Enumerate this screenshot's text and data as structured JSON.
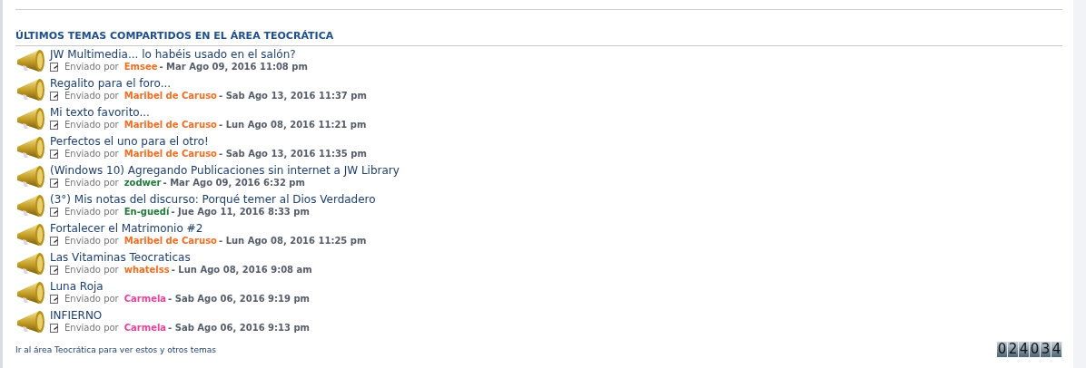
{
  "section": {
    "title": "ÚLTIMOS TEMAS COMPARTIDOS EN EL ÁREA TEOCRÁTICA",
    "topics": [
      {
        "title": "JW Multimedia... lo habéis usado en el salón?",
        "posted_by": "Enviado por",
        "author": "Emsee",
        "color": "#f26d21",
        "date": "- Mar Ago 09, 2016 11:08 pm"
      },
      {
        "title": "Regalito para el foro...",
        "posted_by": "Enviado por",
        "author": "Maribel de Caruso",
        "color": "#f26d21",
        "date": "- Sab Ago 13, 2016 11:37 pm"
      },
      {
        "title": "Mi texto favorito...",
        "posted_by": "Enviado por",
        "author": "Maribel de Caruso",
        "color": "#f26d21",
        "date": "- Lun Ago 08, 2016 11:21 pm"
      },
      {
        "title": "Perfectos el uno para el otro!",
        "posted_by": "Enviado por",
        "author": "Maribel de Caruso",
        "color": "#f26d21",
        "date": "- Sab Ago 13, 2016 11:35 pm"
      },
      {
        "title": "(Windows 10) Agregando Publicaciones sin internet a JW Library",
        "posted_by": "Enviado por",
        "author": "zodwer",
        "color": "#237a3c",
        "date": "- Mar Ago 09, 2016 6:32 pm"
      },
      {
        "title": "(3°) Mis notas del discurso: Porqué temer al Dios Verdadero",
        "posted_by": "Enviado por",
        "author": "En-guedí",
        "color": "#237a3c",
        "date": "- Jue Ago 11, 2016 8:33 pm"
      },
      {
        "title": "Fortalecer el Matrimonio #2",
        "posted_by": "Enviado por",
        "author": "Maribel de Caruso",
        "color": "#f26d21",
        "date": "- Lun Ago 08, 2016 11:25 pm"
      },
      {
        "title": "Las Vitaminas Teocraticas",
        "posted_by": "Enviado por",
        "author": "whatelss",
        "color": "#f26d21",
        "date": "- Lun Ago 08, 2016 9:08 am"
      },
      {
        "title": "Luna Roja",
        "posted_by": "Enviado por",
        "author": "Carmela",
        "color": "#e8419f",
        "date": "- Sab Ago 06, 2016 9:19 pm"
      },
      {
        "title": "INFIERNO",
        "posted_by": "Enviado por",
        "author": "Carmela",
        "color": "#e8419f",
        "date": "- Sab Ago 06, 2016 9:13 pm"
      }
    ],
    "footer_link": "Ir al área Teocrática para ver estos y otros temas"
  },
  "counter": [
    "0",
    "2",
    "4",
    "0",
    "3",
    "4"
  ]
}
